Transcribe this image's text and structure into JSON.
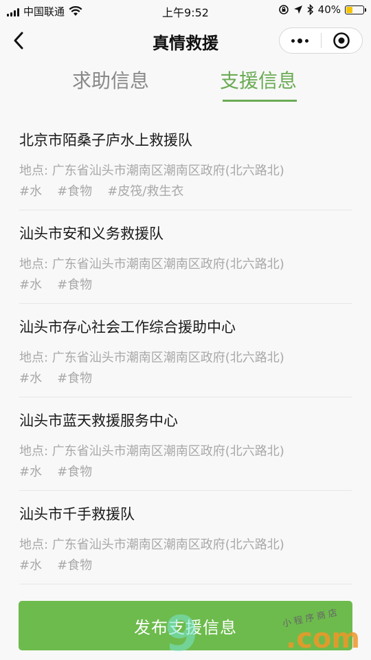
{
  "status_bar": {
    "carrier": "中国联通",
    "time": "上午9:52",
    "battery_percent": "40%",
    "battery_level": 0.4
  },
  "nav": {
    "title": "真情救援"
  },
  "tabs": [
    {
      "label": "求助信息",
      "active": false
    },
    {
      "label": "支援信息",
      "active": true
    }
  ],
  "list": [
    {
      "name": "北京市陌桑子庐水上救援队",
      "address": "地点: 广东省汕头市潮南区潮南区政府(北六路北)",
      "tags": [
        "#水",
        "#食物",
        "#皮筏/救生衣"
      ]
    },
    {
      "name": "汕头市安和义务救援队",
      "address": "地点: 广东省汕头市潮南区潮南区政府(北六路北)",
      "tags": [
        "#水",
        "#食物"
      ]
    },
    {
      "name": "汕头市存心社会工作综合援助中心",
      "address": "地点: 广东省汕头市潮南区潮南区政府(北六路北)",
      "tags": [
        "#水",
        "#食物"
      ]
    },
    {
      "name": "汕头市蓝天救援服务中心",
      "address": "地点: 广东省汕头市潮南区潮南区政府(北六路北)",
      "tags": [
        "#水",
        "#食物"
      ]
    },
    {
      "name": "汕头市千手救援队",
      "address": "地点: 广东省汕头市潮南区潮南区政府(北六路北)",
      "tags": [
        "#水",
        "#食物"
      ]
    }
  ],
  "publish_button": {
    "label": "发布支援信息"
  },
  "watermark": {
    "main": "9",
    "domain": ".com",
    "small": "小程序商店"
  },
  "colors": {
    "accent": "#6aab54",
    "button": "#6dbb4d",
    "muted_text": "#a8a8a8"
  }
}
